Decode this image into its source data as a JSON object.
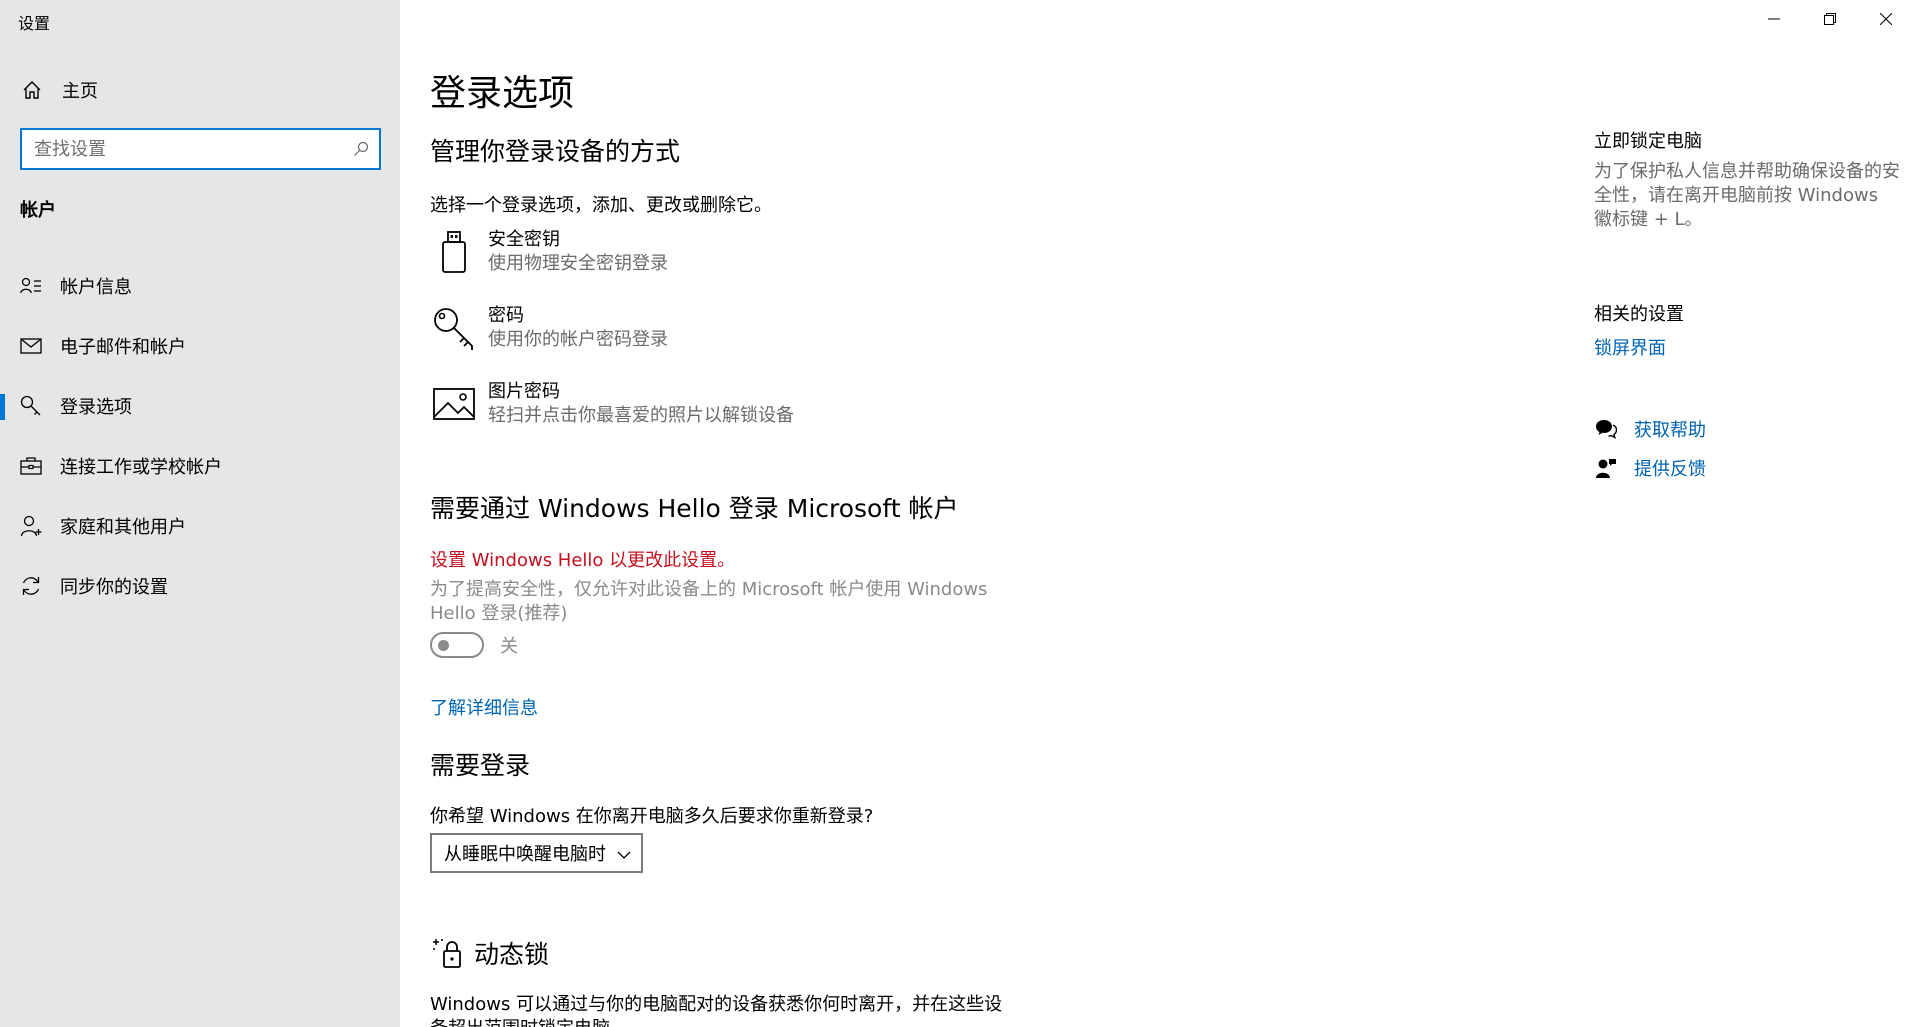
{
  "window": {
    "title": "设置",
    "minimize": "minimize-icon",
    "restore": "restore-icon",
    "close": "close-icon"
  },
  "sidebar": {
    "home_label": "主页",
    "search_placeholder": "查找设置",
    "section_title": "帐户",
    "items": [
      {
        "label": "帐户信息",
        "icon": "person-info-icon",
        "active": false
      },
      {
        "label": "电子邮件和帐户",
        "icon": "mail-icon",
        "active": false
      },
      {
        "label": "登录选项",
        "icon": "key-icon",
        "active": true
      },
      {
        "label": "连接工作或学校帐户",
        "icon": "briefcase-icon",
        "active": false
      },
      {
        "label": "家庭和其他用户",
        "icon": "person-add-icon",
        "active": false
      },
      {
        "label": "同步你的设置",
        "icon": "sync-icon",
        "active": false
      }
    ]
  },
  "main": {
    "title": "登录选项",
    "manage_heading": "管理你登录设备的方式",
    "manage_desc": "选择一个登录选项，添加、更改或删除它。",
    "options": [
      {
        "title": "安全密钥",
        "desc": "使用物理安全密钥登录",
        "icon": "usb-key-icon"
      },
      {
        "title": "密码",
        "desc": "使用你的帐户密码登录",
        "icon": "password-key-icon"
      },
      {
        "title": "图片密码",
        "desc": "轻扫并点击你最喜爱的照片以解锁设备",
        "icon": "picture-icon"
      }
    ],
    "hello_heading": "需要通过 Windows Hello 登录 Microsoft 帐户",
    "hello_warning": "设置 Windows Hello 以更改此设置。",
    "hello_desc_line1": "为了提高安全性，仅允许对此设备上的 Microsoft 帐户使用 Windows",
    "hello_desc_line2": "Hello 登录(推荐)",
    "toggle_state": "关",
    "learn_more": "了解详细信息",
    "require_heading": "需要登录",
    "require_question": "你希望 Windows 在你离开电脑多久后要求你重新登录?",
    "require_value": "从睡眠中唤醒电脑时",
    "dynamic_heading": "动态锁",
    "dynamic_desc_line1": "Windows 可以通过与你的电脑配对的设备获悉你何时离开，并在这些设",
    "dynamic_desc_line2": "备超出范围时锁定电脑。"
  },
  "right": {
    "lock_heading": "立即锁定电脑",
    "lock_desc": "为了保护私人信息并帮助确保设备的安全性，请在离开电脑前按 Windows 徽标键 + L。",
    "related_heading": "相关的设置",
    "lockscreen_link": "锁屏界面",
    "get_help": "获取帮助",
    "feedback": "提供反馈"
  },
  "colors": {
    "accent": "#0078d7",
    "link": "#0063b1",
    "warning": "#c50f1f",
    "sidebar_bg": "#e6e6e6"
  }
}
